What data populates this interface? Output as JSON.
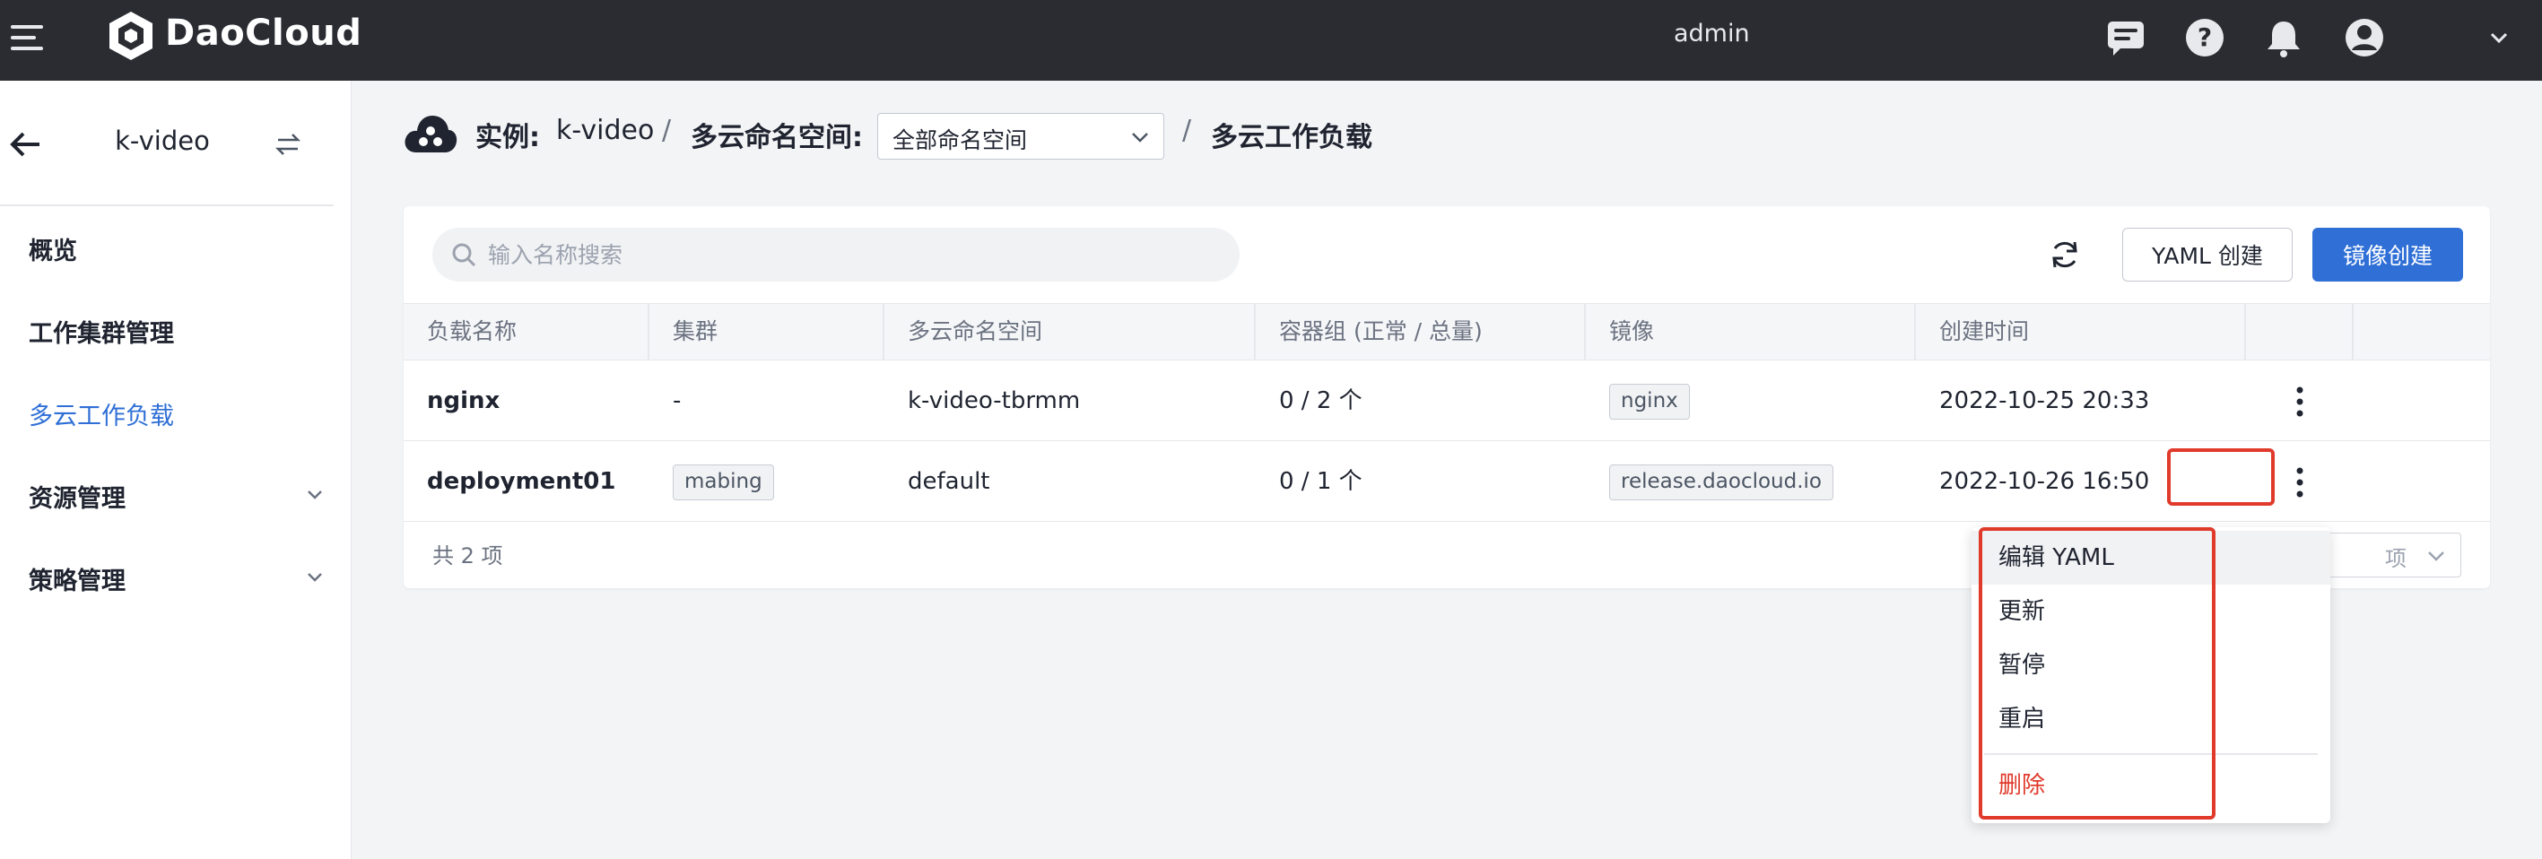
{
  "app": {
    "brand": "DaoCloud",
    "user": "admin"
  },
  "sidebar": {
    "title": "k-video",
    "items": [
      {
        "label": "概览"
      },
      {
        "label": "工作集群管理"
      },
      {
        "label": "多云工作负载"
      },
      {
        "label": "资源管理"
      },
      {
        "label": "策略管理"
      }
    ]
  },
  "breadcrumb": {
    "instance_label": "实例:",
    "instance_value": "k-video",
    "namespace_label": "多云命名空间:",
    "namespace_select": "全部命名空间",
    "current": "多云工作负载",
    "separator": "/"
  },
  "toolbar": {
    "search_placeholder": "输入名称搜索",
    "yaml_create": "YAML 创建",
    "image_create": "镜像创建"
  },
  "table": {
    "columns": [
      "负载名称",
      "集群",
      "多云命名空间",
      "容器组 (正常 / 总量)",
      "镜像",
      "创建时间"
    ],
    "rows": [
      {
        "name": "nginx",
        "cluster": "-",
        "namespace": "k-video-tbrmm",
        "pods": "0 / 2 个",
        "image": "nginx",
        "created": "2022-10-25 20:33"
      },
      {
        "name": "deployment01",
        "cluster": "mabing",
        "namespace": "default",
        "pods": "0 / 1 个",
        "image": "release.daocloud.io",
        "created": "2022-10-26 16:50"
      }
    ],
    "total": "共 2 项",
    "pager_partial": "项"
  },
  "menu": {
    "items": [
      "编辑 YAML",
      "更新",
      "暂停",
      "重启"
    ],
    "danger": "删除"
  },
  "colors": {
    "accent": "#2f6fd6",
    "topbar": "#2a2c32",
    "danger": "#e03a2b"
  }
}
